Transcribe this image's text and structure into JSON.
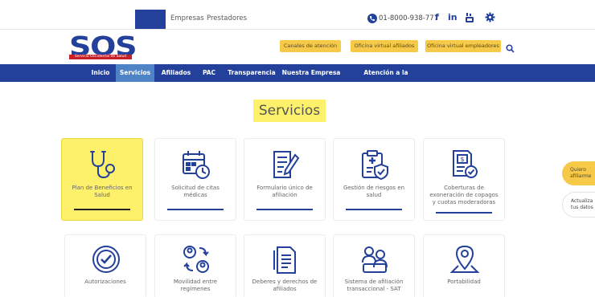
{
  "topbar": {
    "links": [
      "Empresas",
      "Prestadores"
    ],
    "phone": "01-8000-938-777",
    "social": [
      "f",
      "in",
      "yt"
    ]
  },
  "logo": {
    "text": "SOS",
    "subtitle": "Servicio Occidental de Salud"
  },
  "header_buttons": [
    "Canales de atención",
    "Oficina virtual afiliados",
    "Oficina virtual empleadores"
  ],
  "nav": {
    "items": [
      "Inicio",
      "Servicios",
      "Afiliados",
      "PAC",
      "Transparencia",
      "Nuestra Empresa",
      "Atención a la Ciudadanía"
    ],
    "active": "Servicios"
  },
  "page_title": "Servicios",
  "cards": [
    {
      "label": "Plan de Beneficios en Salud",
      "icon": "stethoscope-icon",
      "highlighted": true
    },
    {
      "label": "Solicitud de citas médicas",
      "icon": "calendar-clock-icon"
    },
    {
      "label": "Formulario único de afiliación",
      "icon": "form-pencil-icon"
    },
    {
      "label": "Gestión de riesgos en salud",
      "icon": "clipboard-shield-icon"
    },
    {
      "label": "Coberturas de exoneración de copagos y cuotas moderadoras",
      "icon": "document-check-icon"
    },
    {
      "label": "Autorizaciones",
      "icon": "check-circle-icon"
    },
    {
      "label": "Movilidad entre regímenes",
      "icon": "people-exchange-icon"
    },
    {
      "label": "Deberes y derechos de afiliados",
      "icon": "document-list-icon"
    },
    {
      "label": "Sistema de afiliación transaccional - SAT",
      "icon": "people-group-icon"
    },
    {
      "label": "Portabilidad",
      "icon": "map-pin-icon"
    }
  ],
  "side_tabs": [
    "Quiero afiliarme",
    "Actualiza tus datos"
  ],
  "colors": {
    "brand_blue": "#23409a",
    "nav_active": "#4f83c8",
    "highlight_yellow": "#fdf06a",
    "button_yellow": "#f7c948",
    "logo_red": "#c8202a"
  }
}
